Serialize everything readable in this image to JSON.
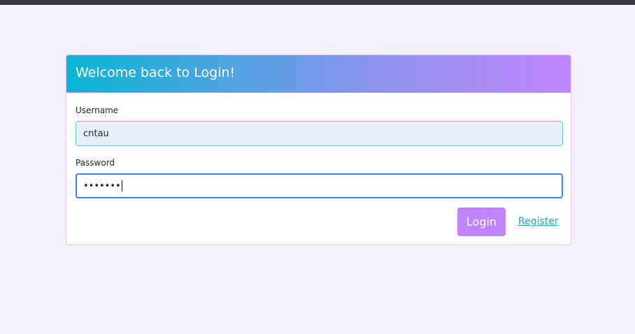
{
  "card": {
    "title": "Welcome back to Login!"
  },
  "form": {
    "username_label": "Username",
    "username_value": "cntau",
    "password_label": "Password",
    "password_value": "•••••••"
  },
  "actions": {
    "login_label": "Login",
    "register_label": "Register"
  },
  "colors": {
    "gradient_start": "#0bb5d6",
    "gradient_end": "#c084fc",
    "button": "#c084fc",
    "link": "#1aa9c6",
    "background": "#f4f0fd"
  }
}
